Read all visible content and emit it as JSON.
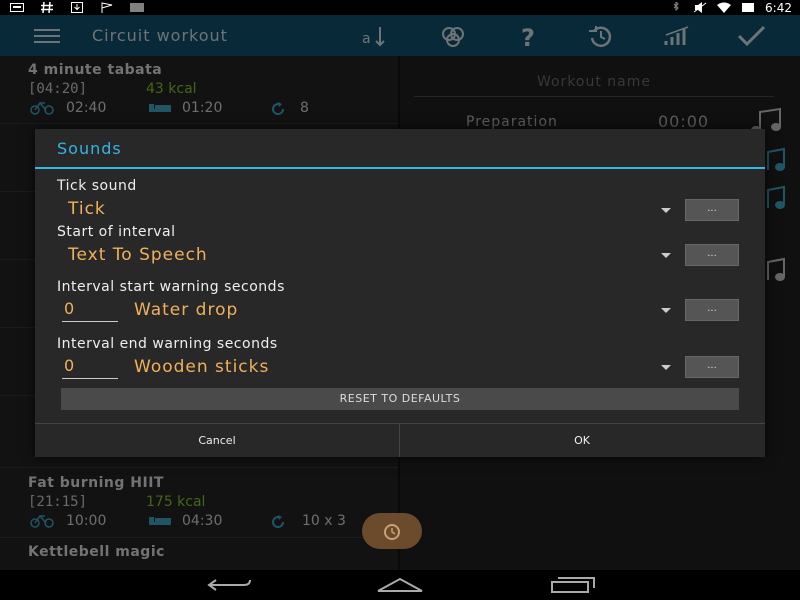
{
  "status_bar": {
    "time": "6:42",
    "left_icons": [
      "keyboard-icon",
      "hash-icon",
      "download-icon",
      "flag-icon",
      "barcode-icon"
    ],
    "right_icons": [
      "bluetooth-icon",
      "mute-icon",
      "wifi-icon",
      "battery-icon"
    ]
  },
  "action_bar": {
    "title": "Circuit workout",
    "color": "#0f4e66",
    "icons": [
      "sort-icon",
      "circles-icon",
      "help-icon",
      "history-icon",
      "stats-icon",
      "check-icon"
    ]
  },
  "list": {
    "items": [
      {
        "title": "4 minute tabata",
        "duration": "[04:20]",
        "kcal": "43 kcal",
        "work": "02:40",
        "rest": "01:20",
        "reps": "8"
      },
      {
        "title": "Fat burning HIIT",
        "duration": "[21:15]",
        "kcal": "175 kcal",
        "work": "10:00",
        "rest": "04:30",
        "reps": "10 x 3"
      },
      {
        "title": "Kettlebell magic"
      }
    ]
  },
  "right_pane": {
    "workout_name_placeholder": "Workout name",
    "preparation_label": "Preparation",
    "preparation_time": "00:00"
  },
  "dialog": {
    "title": "Sounds",
    "tick_label": "Tick sound",
    "tick_value": "Tick",
    "start_label": "Start of interval",
    "start_value": "Text To Speech",
    "start_warning_label": "Interval start warning seconds",
    "start_warning_seconds": "0",
    "start_warning_value": "Water drop",
    "end_warning_label": "Interval end warning seconds",
    "end_warning_seconds": "0",
    "end_warning_value": "Wooden sticks",
    "dots": "...",
    "reset_label": "RESET TO DEFAULTS",
    "cancel_label": "Cancel",
    "ok_label": "OK",
    "accent_color": "#33b5e5",
    "value_color": "#f0b15a"
  }
}
